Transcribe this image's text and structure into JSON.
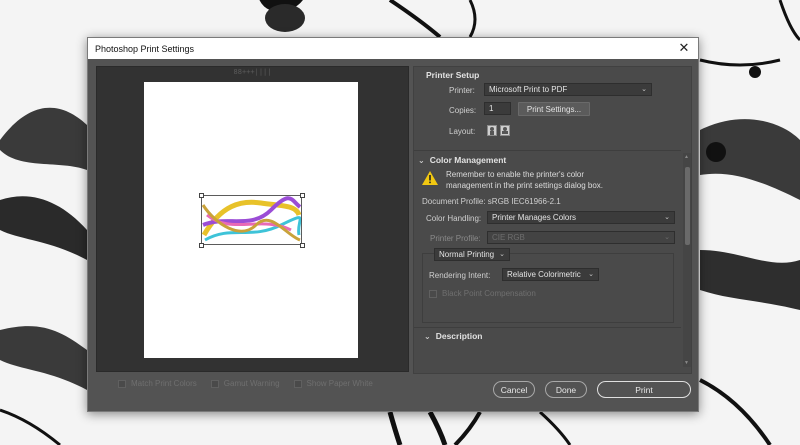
{
  "dialog": {
    "title": "Photoshop Print Settings"
  },
  "preview": {
    "ruler_text": "88+++||||"
  },
  "bottom_options": [
    {
      "label": "Match Print Colors"
    },
    {
      "label": "Gamut Warning"
    },
    {
      "label": "Show Paper White"
    }
  ],
  "printer_setup": {
    "title": "Printer Setup",
    "printer_label": "Printer:",
    "printer_value": "Microsoft Print to PDF",
    "copies_label": "Copies:",
    "copies_value": "1",
    "print_settings_button": "Print Settings...",
    "layout_label": "Layout:"
  },
  "color_management": {
    "title": "Color Management",
    "warning_line1": "Remember to enable the printer's color",
    "warning_line2": "management in the print settings dialog box.",
    "document_profile": "Document Profile: sRGB IEC61966-2.1",
    "color_handling_label": "Color Handling:",
    "color_handling_value": "Printer Manages Colors",
    "printer_profile_label": "Printer Profile:",
    "printer_profile_value": "CIE RGB",
    "normal_printing": "Normal Printing",
    "rendering_intent_label": "Rendering Intent:",
    "rendering_intent_value": "Relative Colorimetric",
    "black_point": "Black Point Compensation"
  },
  "description": {
    "title": "Description"
  },
  "footer": {
    "cancel": "Cancel",
    "done": "Done",
    "print": "Print"
  },
  "colors": {
    "dialog_bg": "#535353",
    "panel_bg": "#4a4a4a",
    "warning": "#f2c811"
  }
}
